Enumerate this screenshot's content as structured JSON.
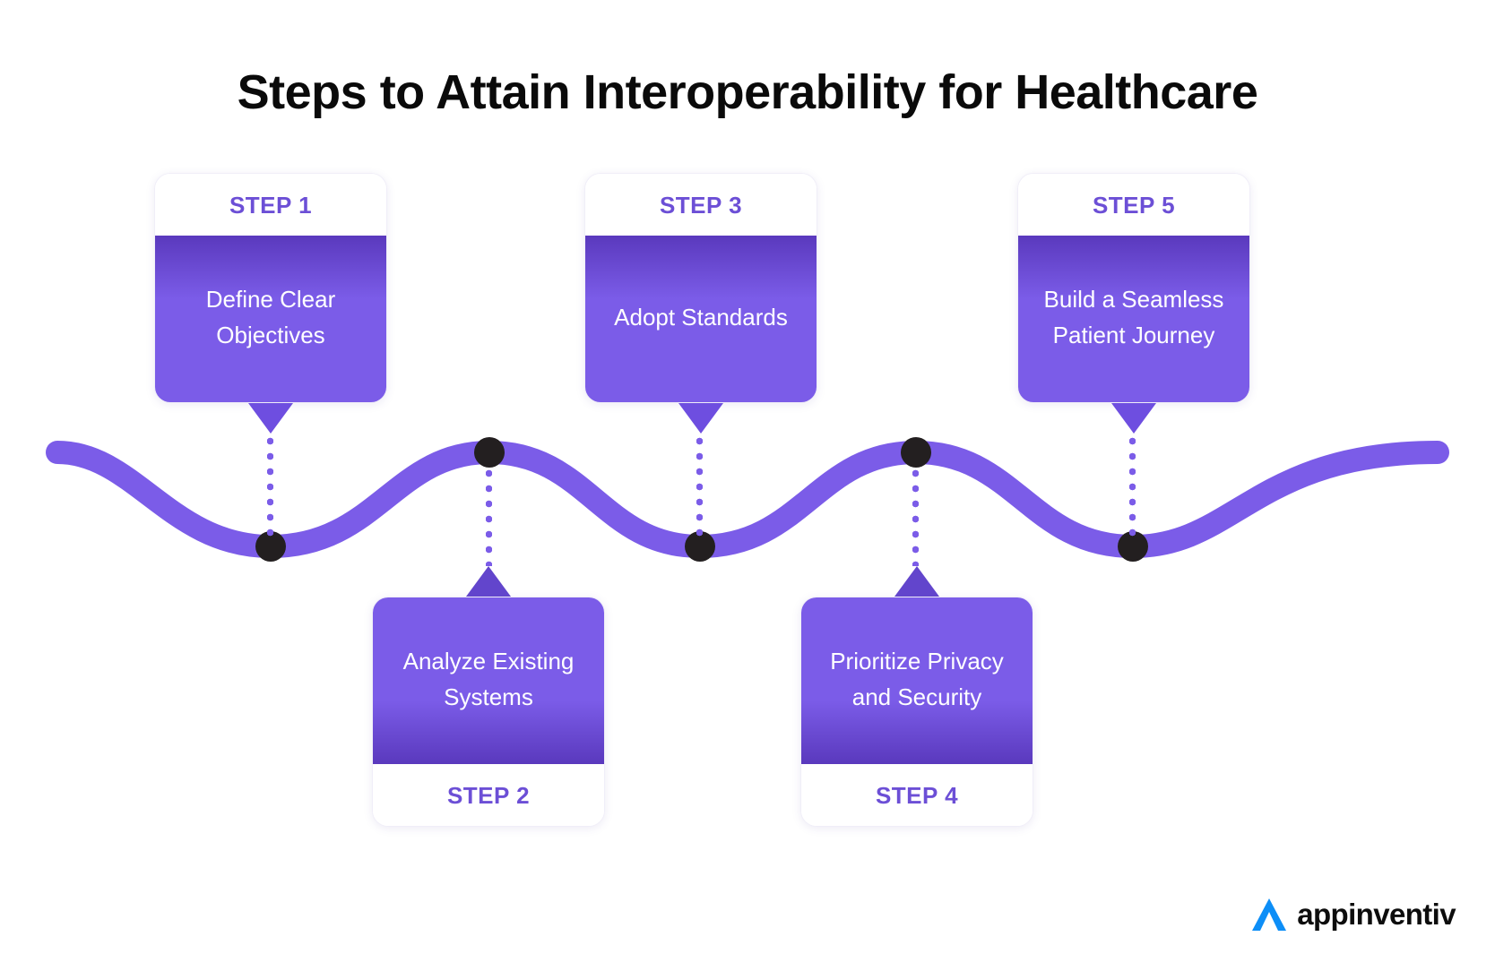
{
  "title": "Steps to Attain Interoperability for Healthcare",
  "colors": {
    "accent_purple": "#7b5ce8",
    "deep_purple": "#5a39bd",
    "step_label_purple": "#6c4fd6",
    "node_dark": "#231f20",
    "logo_blue": "#0d8ef7",
    "background": "#ffffff"
  },
  "steps": [
    {
      "label": "STEP 1",
      "text": "Define Clear Objectives",
      "position": "top"
    },
    {
      "label": "STEP 2",
      "text": "Analyze Existing Systems",
      "position": "bottom"
    },
    {
      "label": "STEP 3",
      "text": "Adopt Standards",
      "position": "top"
    },
    {
      "label": "STEP 4",
      "text": "Prioritize Privacy and Security",
      "position": "bottom"
    },
    {
      "label": "STEP 5",
      "text": "Build a Seamless Patient Journey",
      "position": "top"
    }
  ],
  "logo": {
    "mark": "lambda-chevron-icon",
    "text": "appinventiv"
  }
}
